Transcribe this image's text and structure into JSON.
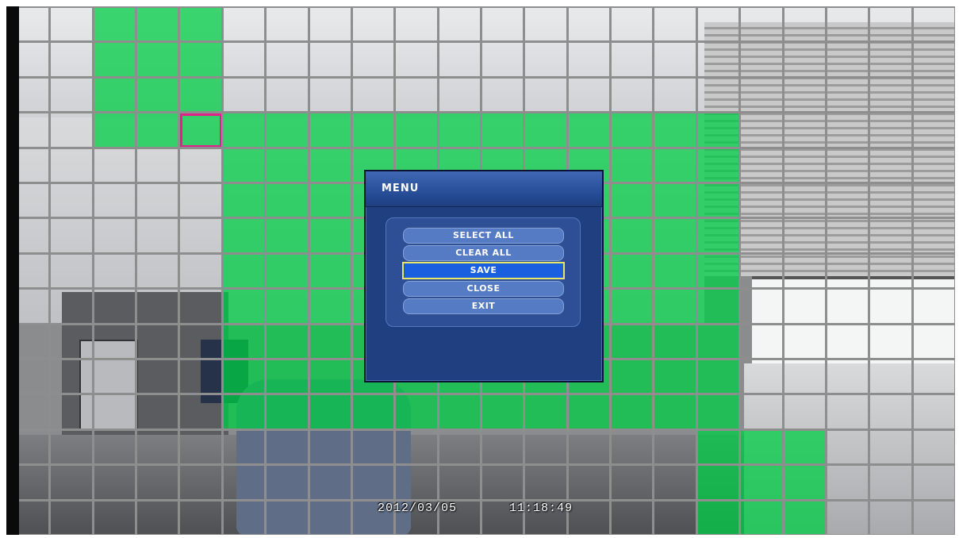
{
  "camera": {
    "date": "2012/03/05",
    "time": "11:18:49"
  },
  "motion_grid": {
    "columns": 22,
    "rows": 15,
    "cursor": {
      "col": 4,
      "row": 3
    },
    "active_cells": [
      [
        2,
        0
      ],
      [
        3,
        0
      ],
      [
        4,
        0
      ],
      [
        2,
        1
      ],
      [
        3,
        1
      ],
      [
        4,
        1
      ],
      [
        2,
        2
      ],
      [
        3,
        2
      ],
      [
        4,
        2
      ],
      [
        2,
        3
      ],
      [
        3,
        3
      ],
      [
        4,
        3
      ],
      [
        5,
        3
      ],
      [
        6,
        3
      ],
      [
        7,
        3
      ],
      [
        8,
        3
      ],
      [
        9,
        3
      ],
      [
        10,
        3
      ],
      [
        11,
        3
      ],
      [
        12,
        3
      ],
      [
        13,
        3
      ],
      [
        14,
        3
      ],
      [
        15,
        3
      ],
      [
        16,
        3
      ],
      [
        5,
        4
      ],
      [
        6,
        4
      ],
      [
        7,
        4
      ],
      [
        8,
        4
      ],
      [
        9,
        4
      ],
      [
        10,
        4
      ],
      [
        11,
        4
      ],
      [
        12,
        4
      ],
      [
        13,
        4
      ],
      [
        14,
        4
      ],
      [
        15,
        4
      ],
      [
        16,
        4
      ],
      [
        5,
        5
      ],
      [
        6,
        5
      ],
      [
        7,
        5
      ],
      [
        8,
        5
      ],
      [
        9,
        5
      ],
      [
        10,
        5
      ],
      [
        11,
        5
      ],
      [
        12,
        5
      ],
      [
        13,
        5
      ],
      [
        14,
        5
      ],
      [
        15,
        5
      ],
      [
        16,
        5
      ],
      [
        5,
        6
      ],
      [
        6,
        6
      ],
      [
        7,
        6
      ],
      [
        8,
        6
      ],
      [
        9,
        6
      ],
      [
        10,
        6
      ],
      [
        11,
        6
      ],
      [
        12,
        6
      ],
      [
        13,
        6
      ],
      [
        14,
        6
      ],
      [
        15,
        6
      ],
      [
        16,
        6
      ],
      [
        5,
        7
      ],
      [
        6,
        7
      ],
      [
        7,
        7
      ],
      [
        8,
        7
      ],
      [
        9,
        7
      ],
      [
        10,
        7
      ],
      [
        11,
        7
      ],
      [
        12,
        7
      ],
      [
        13,
        7
      ],
      [
        14,
        7
      ],
      [
        15,
        7
      ],
      [
        16,
        7
      ],
      [
        5,
        8
      ],
      [
        6,
        8
      ],
      [
        7,
        8
      ],
      [
        8,
        8
      ],
      [
        9,
        8
      ],
      [
        10,
        8
      ],
      [
        11,
        8
      ],
      [
        12,
        8
      ],
      [
        13,
        8
      ],
      [
        14,
        8
      ],
      [
        15,
        8
      ],
      [
        16,
        8
      ],
      [
        5,
        9
      ],
      [
        6,
        9
      ],
      [
        7,
        9
      ],
      [
        8,
        9
      ],
      [
        9,
        9
      ],
      [
        10,
        9
      ],
      [
        11,
        9
      ],
      [
        12,
        9
      ],
      [
        13,
        9
      ],
      [
        14,
        9
      ],
      [
        15,
        9
      ],
      [
        16,
        9
      ],
      [
        5,
        10
      ],
      [
        6,
        10
      ],
      [
        7,
        10
      ],
      [
        8,
        10
      ],
      [
        9,
        10
      ],
      [
        10,
        10
      ],
      [
        11,
        10
      ],
      [
        12,
        10
      ],
      [
        13,
        10
      ],
      [
        14,
        10
      ],
      [
        15,
        10
      ],
      [
        16,
        10
      ],
      [
        5,
        11
      ],
      [
        6,
        11
      ],
      [
        7,
        11
      ],
      [
        8,
        11
      ],
      [
        9,
        11
      ],
      [
        10,
        11
      ],
      [
        11,
        11
      ],
      [
        12,
        11
      ],
      [
        13,
        11
      ],
      [
        14,
        11
      ],
      [
        15,
        11
      ],
      [
        16,
        11
      ],
      [
        16,
        12
      ],
      [
        17,
        12
      ],
      [
        18,
        12
      ],
      [
        16,
        13
      ],
      [
        17,
        13
      ],
      [
        18,
        13
      ],
      [
        16,
        14
      ],
      [
        17,
        14
      ],
      [
        18,
        14
      ]
    ],
    "colors": {
      "active_fill": "#00cd46",
      "grid_line": "#8e8e8e",
      "cursor_border": "#e0218a"
    }
  },
  "menu": {
    "title": "MENU",
    "items": [
      {
        "label": "SELECT ALL",
        "selected": false
      },
      {
        "label": "CLEAR ALL",
        "selected": false
      },
      {
        "label": "SAVE",
        "selected": true
      },
      {
        "label": "CLOSE",
        "selected": false
      },
      {
        "label": "EXIT",
        "selected": false
      }
    ],
    "colors": {
      "dialog_bg": "#1f3f80",
      "item_bg": "#557bc4",
      "selected_bg": "#1a5fe0",
      "selected_border": "#e6e66a"
    }
  }
}
